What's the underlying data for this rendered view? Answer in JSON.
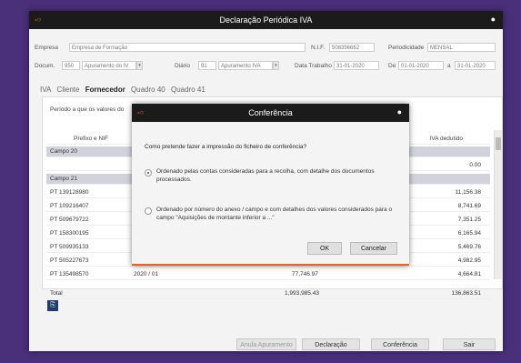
{
  "window": {
    "title": "Declaração Periódica IVA"
  },
  "header": {
    "empresa_label": "Empresa",
    "empresa_value": "Empresa de Formação",
    "nif_label": "N.I.F.",
    "nif_value": "508356662",
    "periodicidade_label": "Periodicidade",
    "periodicidade_value": "MENSAL",
    "docum_label": "Docum.",
    "docum_code": "950",
    "docum_value": "Apuramento do IV",
    "diario_label": "Diário",
    "diario_code": "91",
    "diario_value": "Apuramento IVA",
    "data_trabalho_label": "Data Trabalho",
    "data_trabalho_value": "31-01-2020",
    "de_label": "De",
    "de_value": "01-01-2020",
    "a_label": "a",
    "a_value": "31-01-2020"
  },
  "tabs": [
    "IVA",
    "Cliente",
    "Fornecedor",
    "Quadro 40",
    "Quadro 41"
  ],
  "active_tab": "Fornecedor",
  "panel": {
    "period_label": "Período a que os valores do"
  },
  "grid": {
    "col_prefixo": "Prefixo e NIF",
    "col_iva": "IVA dedutido",
    "rows": [
      {
        "prefixo": "Campo 20",
        "mid": "",
        "iva": "",
        "section": true
      },
      {
        "prefixo": "",
        "mid": "",
        "iva": "0.00",
        "section": false
      },
      {
        "prefixo": "Campo 21",
        "mid": "",
        "iva": "",
        "section": true
      },
      {
        "prefixo": "PT 139128980",
        "mid": "",
        "iva": "11,156.38",
        "section": false
      },
      {
        "prefixo": "PT 109216407",
        "mid": "",
        "iva": "8,741.69",
        "section": false
      },
      {
        "prefixo": "PT 509679722",
        "mid": "",
        "iva": "7,351.25",
        "section": false
      },
      {
        "prefixo": "PT 158300195",
        "mid": "",
        "iva": "6,165.94",
        "section": false
      },
      {
        "prefixo": "PT 509935133",
        "mid": "",
        "iva": "5,469.76",
        "section": false
      },
      {
        "prefixo": "PT 505227673",
        "mid": "",
        "iva": "4,982.95",
        "section": false
      },
      {
        "prefixo": "PT 135498570",
        "mid": "2020 / 01",
        "iva": "4,664.81",
        "mid_val": "77,746.97",
        "section": false
      }
    ],
    "total_label": "Total",
    "total_mid": "1,993,985.43",
    "total_iva": "136,863.51"
  },
  "buttons": {
    "anula": "Anula Apuramento",
    "declaracao": "Declaração",
    "conferencia": "Conferência",
    "sair": "Sair"
  },
  "modal": {
    "title": "Conferência",
    "question": "Como pretende fazer a impressão do ficheiro de conferência?",
    "option1": "Ordenado pelas contas consideradas para a recolha, com detalhe dos documentos processados.",
    "option2": "Ordenado por número do anexo / campo e com detalhes dos valores considerados para o campo \"Aquisições de montante inferior a ...\"",
    "ok": "OK",
    "cancel": "Cancelar"
  },
  "colors": {
    "accent": "#e8632b",
    "titlebar": "#1b1b1b",
    "background": "#4a2f7a"
  }
}
